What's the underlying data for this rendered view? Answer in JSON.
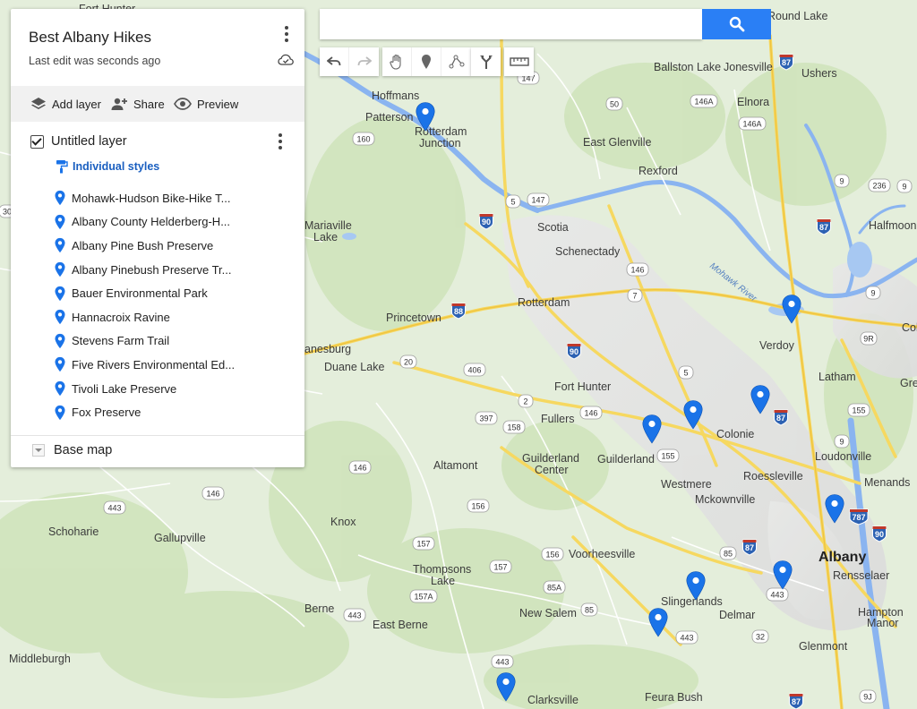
{
  "panel": {
    "title": "Best Albany Hikes",
    "subtitle": "Last edit was seconds ago",
    "toolbar": {
      "add_layer": "Add layer",
      "share": "Share",
      "preview": "Preview"
    },
    "layer": {
      "name": "Untitled layer",
      "checked": true,
      "style_link": "Individual styles",
      "items": [
        {
          "label": "Mohawk-Hudson Bike-Hike T..."
        },
        {
          "label": "Albany County Helderberg-H..."
        },
        {
          "label": "Albany Pine Bush Preserve"
        },
        {
          "label": "Albany Pinebush Preserve Tr..."
        },
        {
          "label": "Bauer Environmental Park"
        },
        {
          "label": "Hannacroix Ravine"
        },
        {
          "label": "Stevens Farm Trail"
        },
        {
          "label": "Five Rivers Environmental Ed..."
        },
        {
          "label": "Tivoli Lake Preserve"
        },
        {
          "label": "Fox Preserve"
        }
      ]
    },
    "base_map": "Base map"
  },
  "search": {
    "value": "",
    "placeholder": ""
  },
  "colors": {
    "marker": "#1a73e8",
    "accent": "#2a7ff5",
    "style_link": "#1a5fc0"
  },
  "icons": {
    "tools": [
      "undo-icon",
      "redo-icon",
      "hand-icon",
      "add-marker-icon",
      "draw-line-icon",
      "directions-icon",
      "ruler-icon"
    ]
  },
  "map": {
    "places": [
      {
        "name": "Fort Hunter"
      },
      {
        "name": "Round Lake"
      },
      {
        "name": "Ballston Lake"
      },
      {
        "name": "Jonesville"
      },
      {
        "name": "Ushers"
      },
      {
        "name": "Hoffmans"
      },
      {
        "name": "Patterson"
      },
      {
        "name": "Rotterdam"
      },
      {
        "name": "Junction"
      },
      {
        "name": "Elnora"
      },
      {
        "name": "East Glenville"
      },
      {
        "name": "Rexford"
      },
      {
        "name": "Mariaville"
      },
      {
        "name": "Lake"
      },
      {
        "name": "Scotia"
      },
      {
        "name": "Schenectady"
      },
      {
        "name": "Halfmoon"
      },
      {
        "name": "Rotterdam"
      },
      {
        "name": "Princetown"
      },
      {
        "name": "Verdoy"
      },
      {
        "name": "anesburg"
      },
      {
        "name": "Duane Lake"
      },
      {
        "name": "Latham"
      },
      {
        "name": "Fort Hunter"
      },
      {
        "name": "Fullers"
      },
      {
        "name": "Colonie"
      },
      {
        "name": "Loudonville"
      },
      {
        "name": "Altamont"
      },
      {
        "name": "Guilderland"
      },
      {
        "name": "Center"
      },
      {
        "name": "Guilderland"
      },
      {
        "name": "Westmere"
      },
      {
        "name": "Mckownville"
      },
      {
        "name": "Roessleville"
      },
      {
        "name": "Menands"
      },
      {
        "name": "Schoharie"
      },
      {
        "name": "Gallupville"
      },
      {
        "name": "Knox"
      },
      {
        "name": "Voorheesville"
      },
      {
        "name": "Thompsons"
      },
      {
        "name": "Lake"
      },
      {
        "name": "Albany"
      },
      {
        "name": "Rensselaer"
      },
      {
        "name": "Slingerlands"
      },
      {
        "name": "Berne"
      },
      {
        "name": "New Salem"
      },
      {
        "name": "Delmar"
      },
      {
        "name": "Hampton"
      },
      {
        "name": "Manor"
      },
      {
        "name": "East Berne"
      },
      {
        "name": "Glenmont"
      },
      {
        "name": "Middleburgh"
      },
      {
        "name": "Clarksville"
      },
      {
        "name": "Feura Bush"
      },
      {
        "name": "Grei"
      },
      {
        "name": "Col"
      }
    ],
    "river_label": "Mohawk River",
    "shields": [
      "147",
      "50",
      "146A",
      "146A",
      "160",
      "5",
      "147",
      "9",
      "236",
      "146",
      "7",
      "9R",
      "20",
      "406",
      "5",
      "2",
      "155",
      "397",
      "146",
      "158",
      "9",
      "155",
      "146",
      "146",
      "156",
      "157",
      "157",
      "156",
      "85",
      "85A",
      "157A",
      "443",
      "85",
      "443",
      "32",
      "443",
      "443",
      "9J",
      "30",
      "443",
      "9",
      "9"
    ],
    "interstate_shields": [
      "87",
      "87",
      "90",
      "88",
      "90",
      "87",
      "87",
      "787",
      "90",
      "87"
    ]
  }
}
